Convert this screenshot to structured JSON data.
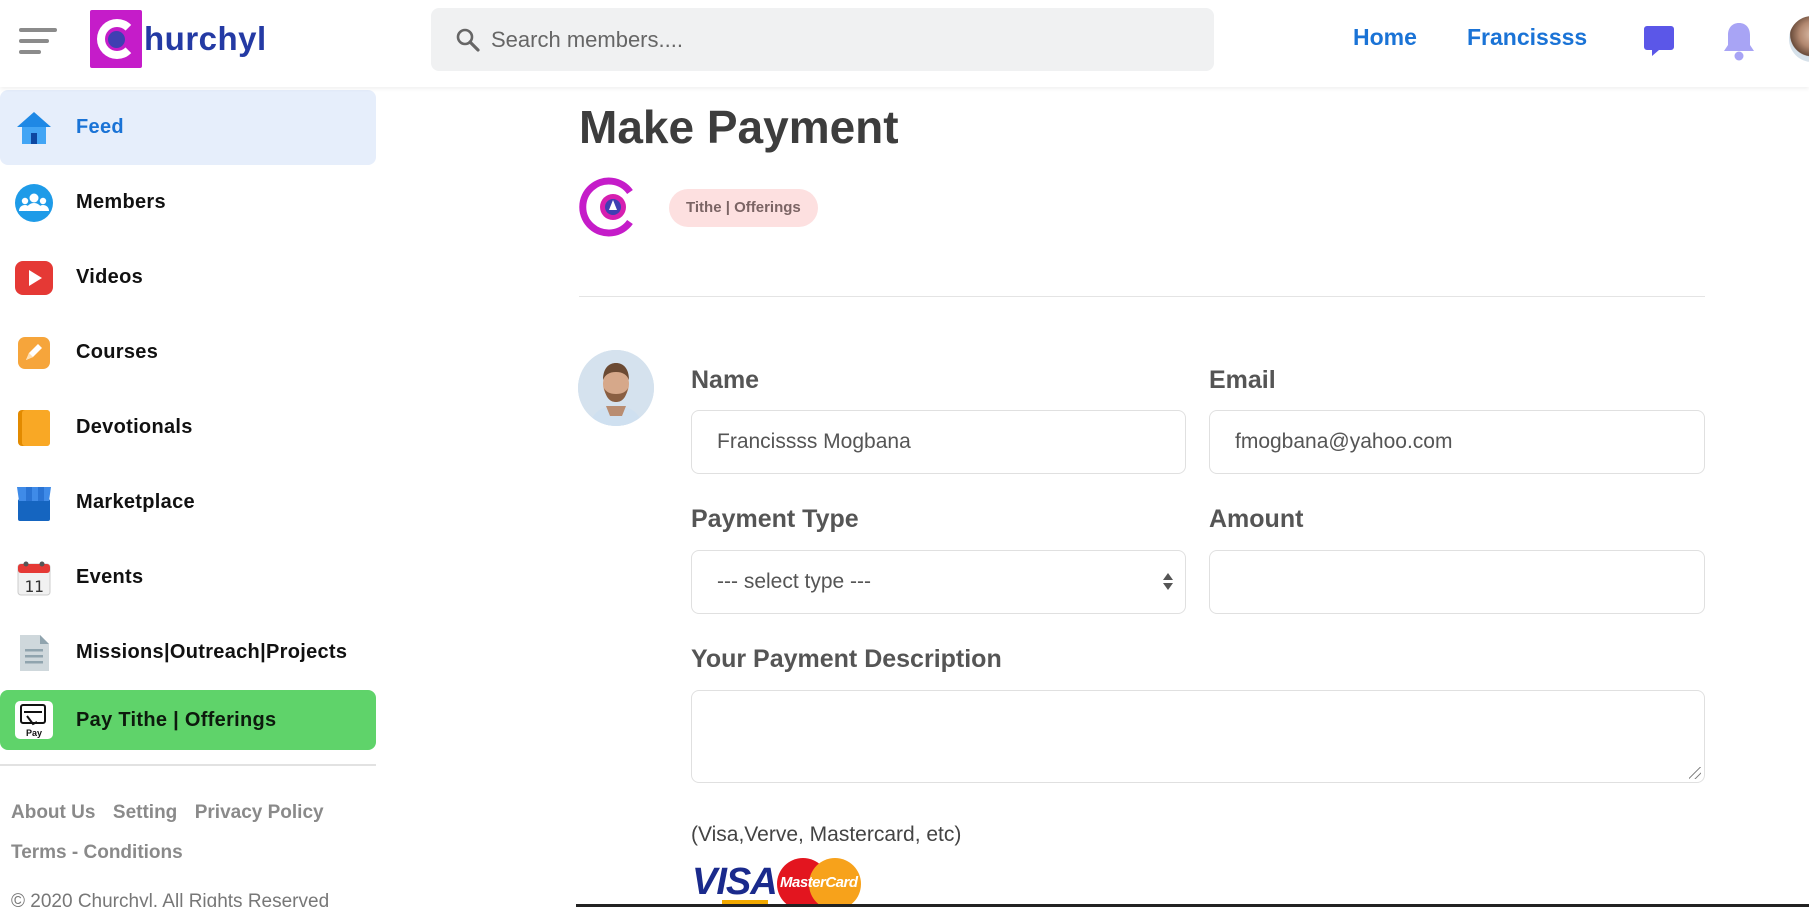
{
  "header": {
    "logo_text": "hurchyl",
    "search_placeholder": "Search members....",
    "nav": {
      "home": "Home",
      "user": "Francissss"
    }
  },
  "sidebar": {
    "items": [
      {
        "label": "Feed",
        "icon": "home-icon",
        "active": true
      },
      {
        "label": "Members",
        "icon": "members-icon"
      },
      {
        "label": "Videos",
        "icon": "video-play-icon"
      },
      {
        "label": "Courses",
        "icon": "courses-icon"
      },
      {
        "label": "Devotionals",
        "icon": "book-icon"
      },
      {
        "label": "Marketplace",
        "icon": "store-icon"
      },
      {
        "label": "Events",
        "icon": "calendar-icon",
        "calendar_day": "11"
      },
      {
        "label": "Missions|Outreach|Projects",
        "icon": "document-icon"
      },
      {
        "label": "Pay Tithe | Offerings",
        "icon": "pay-icon",
        "icon_text": "Pay"
      }
    ],
    "footer_links": [
      "About Us",
      "Setting",
      "Privacy Policy",
      "Terms - Conditions"
    ],
    "copyright": "© 2020 Churchyl. All Rights Reserved"
  },
  "main": {
    "title": "Make Payment",
    "tag": "Tithe | Offerings",
    "form": {
      "name_label": "Name",
      "name_value": "Francissss Mogbana",
      "email_label": "Email",
      "email_value": "fmogbana@yahoo.com",
      "payment_type_label": "Payment Type",
      "payment_type_value": "--- select type ---",
      "amount_label": "Amount",
      "amount_value": "",
      "description_label": "Your Payment Description",
      "description_value": ""
    },
    "cards_note": "(Visa,Verve, Mastercard, etc)",
    "visa_text": "VISA",
    "mastercard_text": "MasterCard"
  },
  "colors": {
    "accent": "#1a73d6",
    "brand": "#c51cc9",
    "pay_green": "#5fd36a",
    "active_bg": "#e6eefb",
    "tag_bg": "#fde0e0"
  }
}
